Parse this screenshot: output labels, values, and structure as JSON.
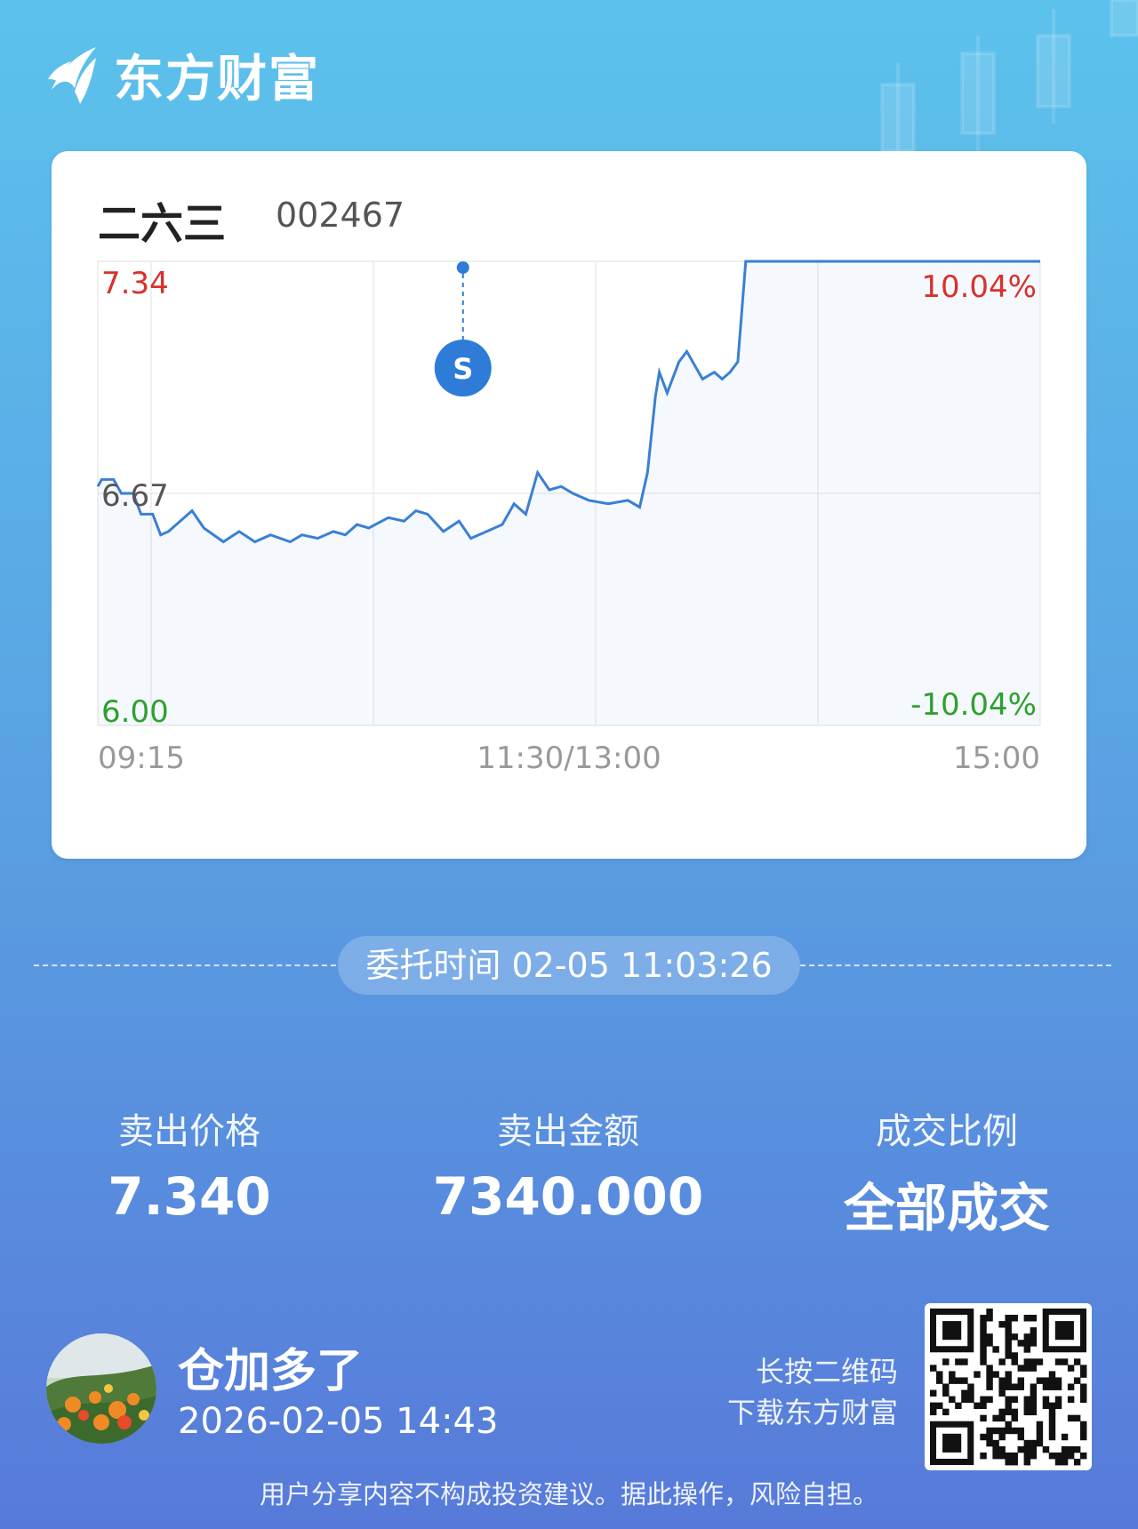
{
  "brand": {
    "name": "东方财富"
  },
  "stock": {
    "name": "二六三",
    "code": "002467"
  },
  "chart_data": {
    "type": "line",
    "title": "",
    "xlabel": "",
    "ylabel": "",
    "y_left_ticks": [
      "7.34",
      "6.67",
      "6.00"
    ],
    "y_right_ticks": [
      "10.04%",
      "-10.04%"
    ],
    "x_ticks": [
      "09:15",
      "11:30/13:00",
      "15:00"
    ],
    "ylim": [
      6.0,
      7.34
    ],
    "grid": true,
    "series": [
      {
        "values": [
          [
            0,
            6.69
          ],
          [
            1,
            6.71
          ],
          [
            4,
            6.71
          ],
          [
            6,
            6.67
          ],
          [
            9,
            6.67
          ],
          [
            11,
            6.61
          ],
          [
            14,
            6.61
          ],
          [
            16,
            6.55
          ],
          [
            18,
            6.56
          ],
          [
            24,
            6.62
          ],
          [
            27,
            6.57
          ],
          [
            32,
            6.53
          ],
          [
            36,
            6.56
          ],
          [
            40,
            6.53
          ],
          [
            44,
            6.55
          ],
          [
            49,
            6.53
          ],
          [
            52,
            6.55
          ],
          [
            56,
            6.54
          ],
          [
            60,
            6.56
          ],
          [
            63,
            6.55
          ],
          [
            66,
            6.58
          ],
          [
            69,
            6.57
          ],
          [
            74,
            6.6
          ],
          [
            78,
            6.59
          ],
          [
            81,
            6.62
          ],
          [
            84,
            6.61
          ],
          [
            88,
            6.56
          ],
          [
            92,
            6.59
          ],
          [
            95,
            6.54
          ],
          [
            99,
            6.56
          ],
          [
            103,
            6.58
          ],
          [
            106,
            6.64
          ],
          [
            109,
            6.61
          ],
          [
            112,
            6.73
          ],
          [
            115,
            6.68
          ],
          [
            118,
            6.69
          ],
          [
            121,
            6.67
          ],
          [
            125,
            6.65
          ],
          [
            130,
            6.64
          ],
          [
            135,
            6.65
          ],
          [
            138,
            6.63
          ],
          [
            140,
            6.73
          ],
          [
            142,
            6.95
          ],
          [
            143,
            7.02
          ],
          [
            145,
            6.96
          ],
          [
            148,
            7.05
          ],
          [
            150,
            7.08
          ],
          [
            152,
            7.04
          ],
          [
            154,
            7.0
          ],
          [
            157,
            7.02
          ],
          [
            159,
            7.0
          ],
          [
            161,
            7.02
          ],
          [
            163,
            7.05
          ],
          [
            165,
            7.34
          ],
          [
            240,
            7.34
          ]
        ]
      }
    ],
    "marker": {
      "label": "S",
      "time": "11:03",
      "value": 7.34,
      "color": "#2f7bd8"
    },
    "colors": {
      "line": "#3a7fd4",
      "up": "#d9302c",
      "down": "#2ea02e",
      "neutral": "#555555"
    }
  },
  "order": {
    "label": "委托时间",
    "datetime": "02-05 11:03:26"
  },
  "stats": [
    {
      "label": "卖出价格",
      "value": "7.340"
    },
    {
      "label": "卖出金额",
      "value": "7340.000"
    },
    {
      "label": "成交比例",
      "value": "全部成交"
    }
  ],
  "user": {
    "name": "仓加多了",
    "time": "2026-02-05 14:43"
  },
  "qr": {
    "hint_line1": "长按二维码",
    "hint_line2": "下载东方财富"
  },
  "disclaimer": "用户分享内容不构成投资建议。据此操作，风险自担。"
}
